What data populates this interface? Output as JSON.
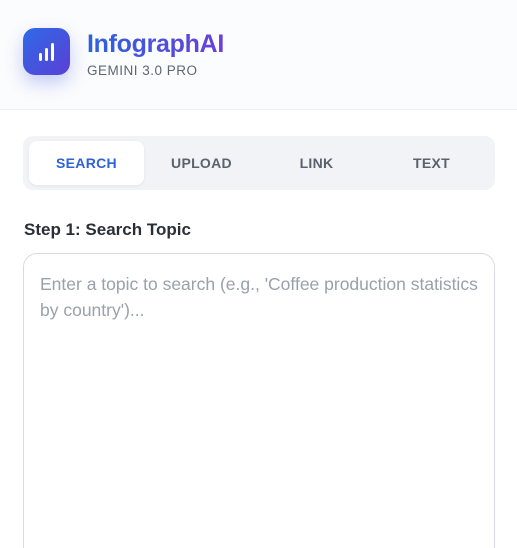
{
  "header": {
    "logo_icon": "bar-chart-icon",
    "title": "InfographAI",
    "subtitle": "GEMINI 3.0 PRO"
  },
  "tabs": [
    {
      "label": "SEARCH",
      "active": true
    },
    {
      "label": "UPLOAD",
      "active": false
    },
    {
      "label": "LINK",
      "active": false
    },
    {
      "label": "TEXT",
      "active": false
    }
  ],
  "step": {
    "label": "Step 1: Search Topic"
  },
  "topic_input": {
    "value": "",
    "placeholder": "Enter a topic to search (e.g., 'Coffee production statistics by country')..."
  },
  "colors": {
    "accent": "#2d62d9",
    "brand_gradient_start": "#2b62e0",
    "brand_gradient_end": "#6b3fd6"
  }
}
